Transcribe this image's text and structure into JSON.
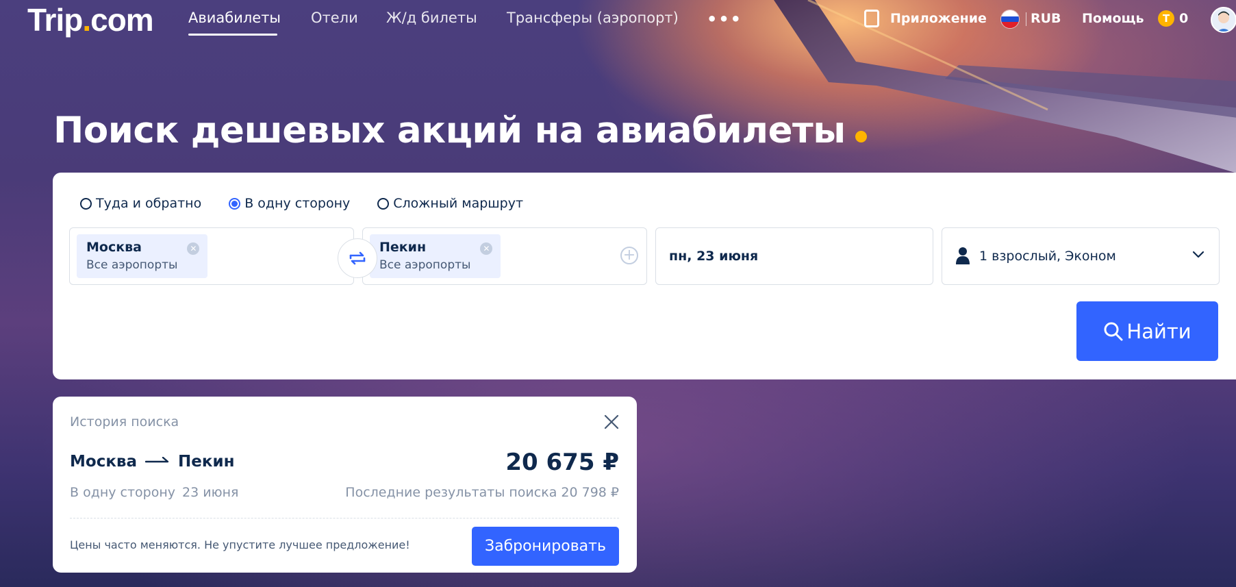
{
  "brand": {
    "logo_main": "Trip",
    "logo_dot": ".",
    "logo_end": "com",
    "accent": "#ffb400",
    "primary": "#3264ff"
  },
  "nav": {
    "items": [
      "Авиабилеты",
      "Отели",
      "Ж/д билеты",
      "Трансферы (аэропорт)"
    ],
    "more": "•••",
    "app_label": "Приложение",
    "currency": "RUB",
    "help": "Помощь",
    "coin_symbol": "T",
    "coins": "0"
  },
  "headline": "Поиск дешевых акций на авиабилеты",
  "search": {
    "trip_types": [
      "Туда и обратно",
      "В одну сторону",
      "Сложный маршрут"
    ],
    "selected_trip_type": "В одну сторону",
    "from": {
      "city": "Москва",
      "sub": "Все аэропорты"
    },
    "to": {
      "city": "Пекин",
      "sub": "Все аэропорты"
    },
    "date": "пн, 23 июня",
    "passengers": "1 взрослый, Эконом",
    "search_label": "Найти",
    "icons": [
      "swap-icon",
      "plus-icon",
      "person-icon",
      "chevron-down-icon",
      "search-icon"
    ]
  },
  "history": {
    "title": "История поиска",
    "from": "Москва",
    "to": "Пекин",
    "price": "20 675 ₽",
    "trip_type": "В одну сторону",
    "date": "23 июня",
    "last_results": "Последние результаты поиска 20 798 ₽",
    "note": "Цены часто меняются. Не упустите лучшее предложение!",
    "book_label": "Забронировать"
  }
}
